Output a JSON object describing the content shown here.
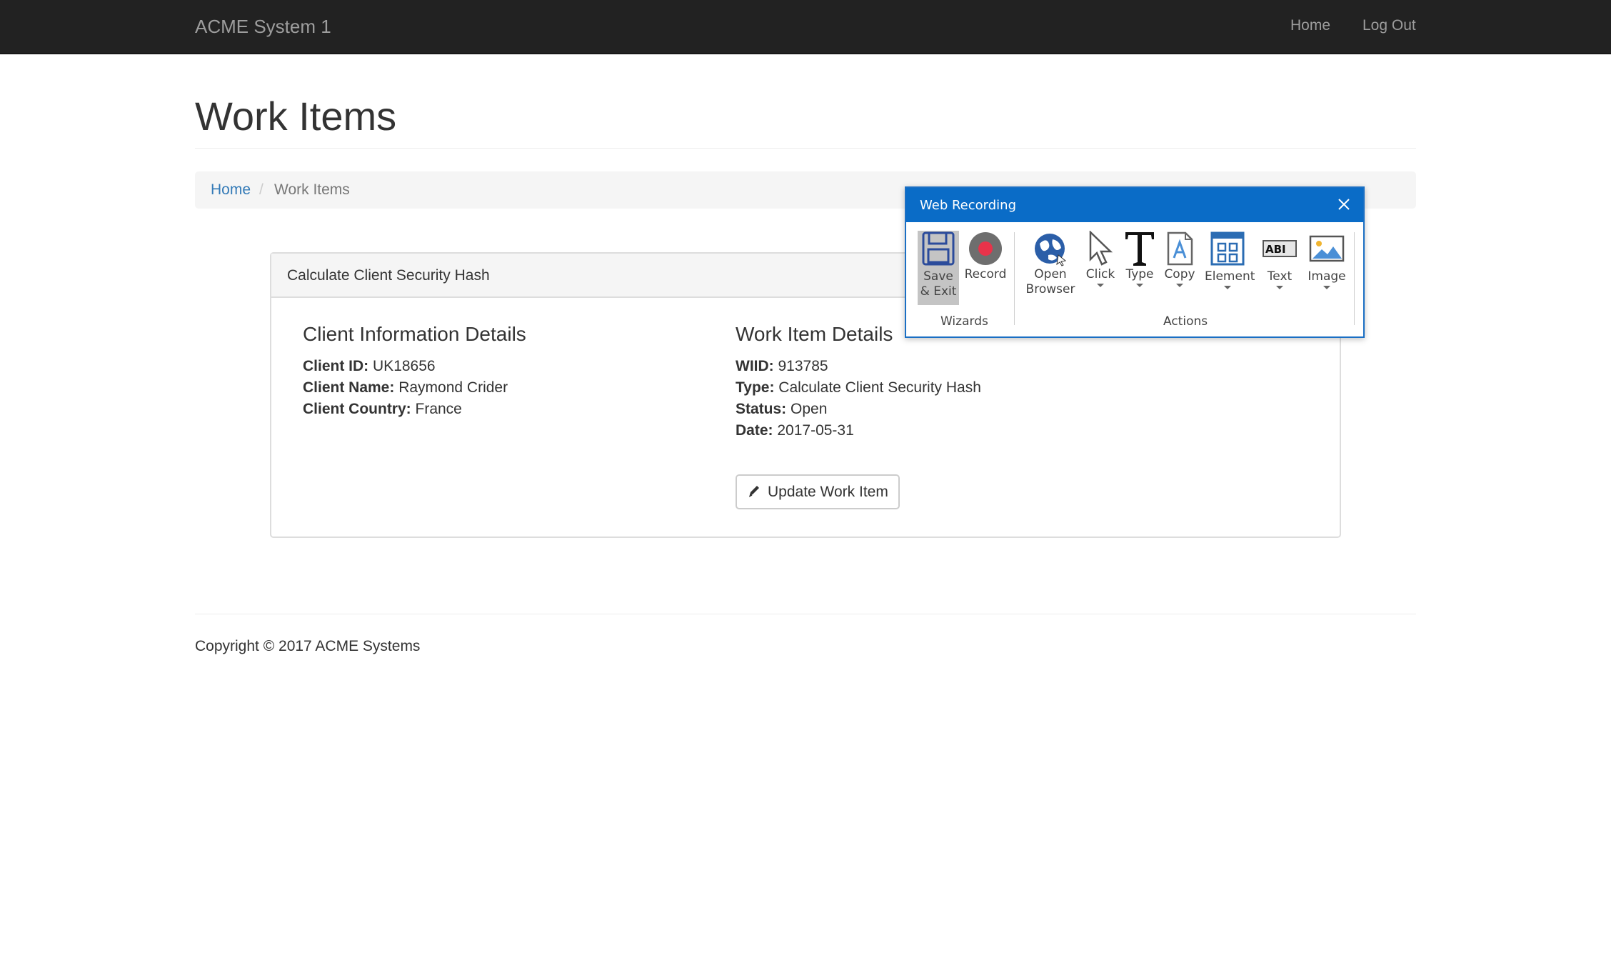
{
  "navbar": {
    "brand": "ACME System 1",
    "links": [
      "Home",
      "Log Out"
    ]
  },
  "page": {
    "title": "Work Items"
  },
  "breadcrumb": {
    "home": "Home",
    "separator": "/",
    "current": "Work Items"
  },
  "panel": {
    "title": "Calculate Client Security Hash",
    "client": {
      "heading": "Client Information Details",
      "rows": [
        {
          "label": "Client ID:",
          "value": "UK18656"
        },
        {
          "label": "Client Name:",
          "value": "Raymond Crider"
        },
        {
          "label": "Client Country:",
          "value": "France"
        }
      ]
    },
    "work_item": {
      "heading": "Work Item Details",
      "rows": [
        {
          "label": "WIID:",
          "value": "913785"
        },
        {
          "label": "Type:",
          "value": "Calculate Client Security Hash"
        },
        {
          "label": "Status:",
          "value": "Open"
        },
        {
          "label": "Date:",
          "value": "2017-05-31"
        }
      ]
    },
    "update_button": "Update Work Item"
  },
  "footer": {
    "copyright": "Copyright © 2017 ACME Systems"
  },
  "recorder": {
    "title": "Web Recording",
    "wizards_label": "Wizards",
    "actions_label": "Actions",
    "tools": {
      "save_exit": [
        "Save",
        "& Exit"
      ],
      "record": "Record",
      "open_browser": [
        "Open",
        "Browser"
      ],
      "click": "Click",
      "type": "Type",
      "copy": "Copy",
      "element": "Element",
      "text": "Text",
      "image": "Image"
    },
    "colors": {
      "titlebar": "#0a6cc7",
      "record_dot": "#e8334a",
      "icon_blue": "#2b6cb3"
    }
  }
}
